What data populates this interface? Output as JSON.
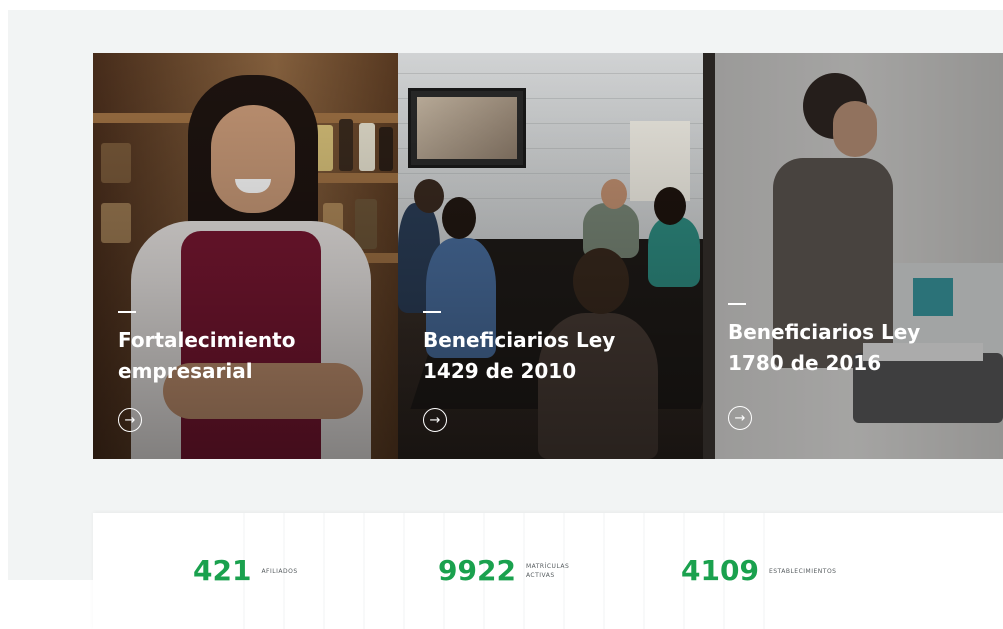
{
  "cards": [
    {
      "title": "Fortalecimiento\nempresarial",
      "arrow_icon": "arrow-right-icon"
    },
    {
      "title": "Beneficiarios Ley\n1429 de 2010",
      "arrow_icon": "arrow-right-icon"
    },
    {
      "title": "Beneficiarios Ley\n1780 de 2016",
      "arrow_icon": "arrow-right-icon"
    }
  ],
  "stats": [
    {
      "number": "421",
      "label": "AFILIADOS"
    },
    {
      "number": "9922",
      "label": "MATRÍCULAS\nACTIVAS"
    },
    {
      "number": "4109",
      "label": "ESTABLECIMIENTOS"
    }
  ],
  "colors": {
    "accent_green": "#1aa14e",
    "band_background": "#f2f4f4",
    "card_text": "#ffffff"
  }
}
